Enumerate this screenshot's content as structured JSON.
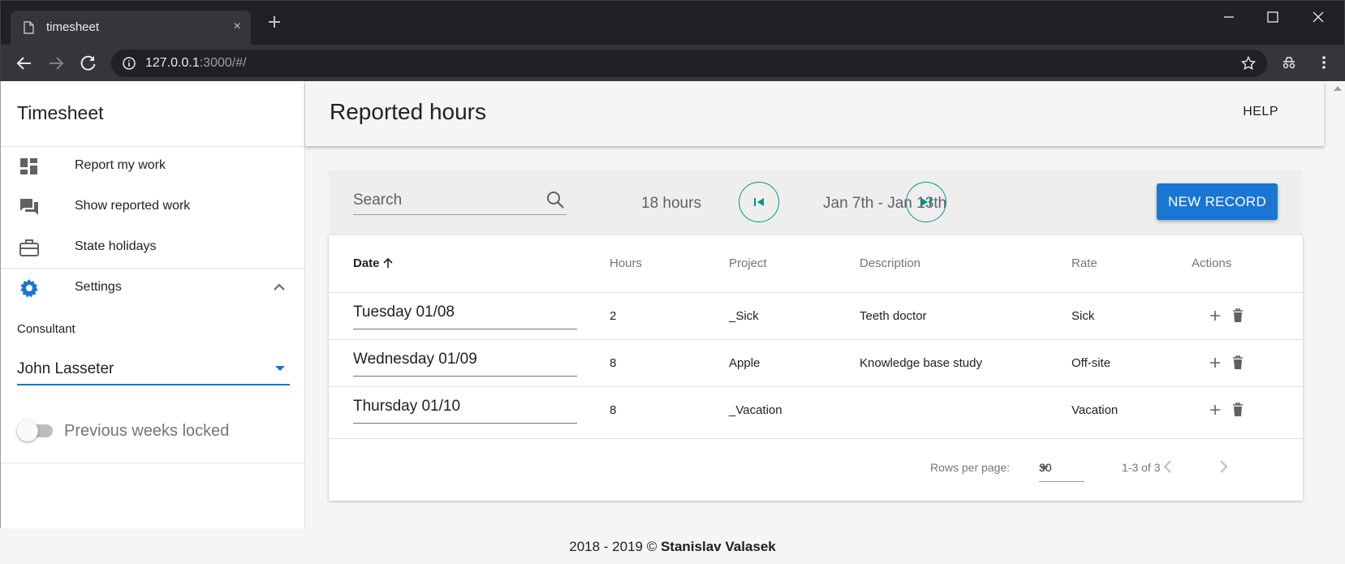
{
  "browser": {
    "tab_title": "timesheet",
    "tab_close": "×",
    "url_host": "127.0.0.1",
    "url_rest": ":3000/#/"
  },
  "drawer": {
    "title": "Timesheet",
    "nav_items": [
      {
        "label": "Report my work",
        "icon": "dashboard-icon"
      },
      {
        "label": "Show reported work",
        "icon": "forum-icon"
      },
      {
        "label": "State holidays",
        "icon": "briefcase-icon"
      },
      {
        "label": "Settings",
        "icon": "gear-icon"
      }
    ],
    "consultant_label": "Consultant",
    "consultant_value": "John Lasseter",
    "lock_label": "Previous weeks locked",
    "lock_enabled": false
  },
  "header": {
    "title": "Reported hours",
    "help": "HELP"
  },
  "filters": {
    "search_placeholder": "Search",
    "total_hours": "18 hours",
    "week_range": "Jan 7th - Jan 13th",
    "new_record": "NEW RECORD"
  },
  "table": {
    "columns": [
      "Date",
      "Hours",
      "Project",
      "Description",
      "Rate",
      "Actions"
    ],
    "sorted_column": "Date",
    "rows": [
      {
        "date": "Tuesday 01/08",
        "hours": "2",
        "project": "_Sick",
        "description": "Teeth doctor",
        "rate": "Sick"
      },
      {
        "date": "Wednesday 01/09",
        "hours": "8",
        "project": "Apple",
        "description": "Knowledge base study",
        "rate": "Off-site"
      },
      {
        "date": "Thursday 01/10",
        "hours": "8",
        "project": "_Vacation",
        "description": "",
        "rate": "Vacation"
      }
    ],
    "rows_per_page_label": "Rows per page:",
    "rows_per_page": "30",
    "range": "1-3 of 3"
  },
  "footer": {
    "years": "2018 - 2019 ©",
    "author": "Stanislav Valasek"
  },
  "colors": {
    "primary": "#1976d2",
    "accent": "#009688",
    "chrome": "#202124"
  }
}
